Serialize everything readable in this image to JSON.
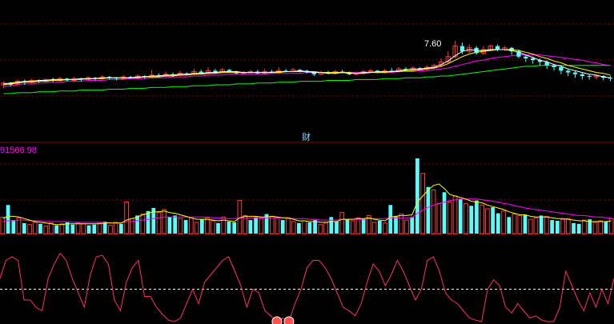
{
  "colors": {
    "background": "#000000",
    "grid": "#8b0000",
    "up": "#ff3b3b",
    "down": "#54ffff",
    "ma_short": "#ffffff",
    "ma_mid": "#ffff00",
    "ma_long": "#ff00ff",
    "ma_longest": "#00ff00",
    "vol_ma_short": "#ffff00",
    "vol_ma_long": "#ff00ff",
    "oscillator": "#ff2a7a",
    "osc_midline": "#ffffff",
    "marker": "#ff5050",
    "label_pink": "#ff00ff",
    "label_cyan": "#8fd3ff"
  },
  "chart_data": [
    {
      "type": "candlestick",
      "panel": "price",
      "annotation_high": "7.60",
      "separator_label": "财",
      "ylim": [
        0,
        100
      ],
      "candles": [
        [
          40,
          42,
          36,
          44
        ],
        [
          42,
          40,
          38,
          43
        ],
        [
          41,
          44,
          39,
          46
        ],
        [
          44,
          43,
          40,
          46
        ],
        [
          43,
          45,
          41,
          47
        ],
        [
          45,
          44,
          42,
          46
        ],
        [
          44,
          46,
          42,
          47
        ],
        [
          46,
          45,
          43,
          48
        ],
        [
          45,
          47,
          43,
          49
        ],
        [
          47,
          45,
          44,
          48
        ],
        [
          45,
          47,
          44,
          49
        ],
        [
          47,
          46,
          44,
          48
        ],
        [
          46,
          48,
          45,
          50
        ],
        [
          48,
          47,
          45,
          49
        ],
        [
          47,
          49,
          46,
          51
        ],
        [
          49,
          48,
          46,
          50
        ],
        [
          48,
          47,
          45,
          49
        ],
        [
          47,
          49,
          46,
          51
        ],
        [
          49,
          48,
          47,
          50
        ],
        [
          48,
          50,
          47,
          52
        ],
        [
          50,
          49,
          47,
          51
        ],
        [
          49,
          51,
          48,
          57
        ],
        [
          51,
          50,
          49,
          53
        ],
        [
          50,
          52,
          49,
          55
        ],
        [
          52,
          51,
          49,
          54
        ],
        [
          51,
          53,
          50,
          56
        ],
        [
          53,
          52,
          51,
          54
        ],
        [
          52,
          55,
          51,
          58
        ],
        [
          55,
          53,
          52,
          57
        ],
        [
          53,
          56,
          52,
          60
        ],
        [
          56,
          54,
          53,
          58
        ],
        [
          54,
          57,
          53,
          59
        ],
        [
          57,
          55,
          54,
          58
        ],
        [
          55,
          53,
          52,
          56
        ],
        [
          53,
          54,
          52,
          56
        ],
        [
          54,
          55,
          53,
          57
        ],
        [
          55,
          53,
          52,
          57
        ],
        [
          53,
          55,
          52,
          58
        ],
        [
          55,
          54,
          53,
          57
        ],
        [
          54,
          56,
          53,
          60
        ],
        [
          56,
          55,
          54,
          58
        ],
        [
          55,
          57,
          54,
          59
        ],
        [
          57,
          56,
          54,
          58
        ],
        [
          56,
          54,
          53,
          57
        ],
        [
          54,
          52,
          50,
          55
        ],
        [
          52,
          54,
          51,
          56
        ],
        [
          54,
          53,
          52,
          56
        ],
        [
          53,
          55,
          52,
          57
        ],
        [
          55,
          54,
          53,
          57
        ],
        [
          54,
          52,
          51,
          55
        ],
        [
          52,
          53,
          51,
          55
        ],
        [
          53,
          55,
          52,
          57
        ],
        [
          55,
          56,
          54,
          58
        ],
        [
          56,
          54,
          53,
          57
        ],
        [
          54,
          56,
          53,
          58
        ],
        [
          56,
          55,
          54,
          59
        ],
        [
          55,
          58,
          54,
          60
        ],
        [
          58,
          57,
          56,
          60
        ],
        [
          57,
          59,
          56,
          61
        ],
        [
          59,
          58,
          57,
          60
        ],
        [
          58,
          60,
          57,
          62
        ],
        [
          60,
          62,
          58,
          64
        ],
        [
          62,
          66,
          60,
          70
        ],
        [
          66,
          72,
          64,
          78
        ],
        [
          72,
          84,
          70,
          90
        ],
        [
          84,
          78,
          75,
          88
        ],
        [
          78,
          82,
          76,
          86
        ],
        [
          82,
          76,
          74,
          84
        ],
        [
          76,
          80,
          74,
          84
        ],
        [
          80,
          84,
          78,
          86
        ],
        [
          84,
          80,
          78,
          86
        ],
        [
          80,
          82,
          78,
          84
        ],
        [
          82,
          78,
          74,
          83
        ],
        [
          78,
          72,
          70,
          80
        ],
        [
          72,
          70,
          66,
          74
        ],
        [
          70,
          68,
          64,
          72
        ],
        [
          68,
          66,
          62,
          70
        ],
        [
          66,
          62,
          58,
          68
        ],
        [
          62,
          60,
          56,
          64
        ],
        [
          60,
          56,
          52,
          62
        ],
        [
          56,
          54,
          50,
          58
        ],
        [
          54,
          52,
          48,
          56
        ],
        [
          52,
          50,
          46,
          54
        ],
        [
          50,
          49,
          46,
          52
        ],
        [
          49,
          50,
          46,
          52
        ],
        [
          50,
          48,
          45,
          51
        ],
        [
          48,
          47,
          44,
          50
        ]
      ],
      "ma": {
        "ma_short": [
          41,
          42,
          43,
          44,
          44,
          45,
          45,
          46,
          46,
          46,
          46,
          47,
          47,
          47,
          48,
          48,
          48,
          48,
          48,
          49,
          49,
          50,
          50,
          51,
          51,
          52,
          52,
          53,
          53,
          54,
          54,
          55,
          55,
          55,
          54,
          54,
          54,
          54,
          54,
          55,
          55,
          55,
          56,
          55,
          54,
          54,
          53,
          53,
          54,
          53,
          53,
          54,
          54,
          55,
          55,
          55,
          56,
          57,
          58,
          58,
          59,
          60,
          63,
          67,
          73,
          78,
          80,
          79,
          79,
          80,
          80,
          80,
          79,
          77,
          74,
          71,
          68,
          66,
          63,
          61,
          58,
          56,
          54,
          52,
          51,
          49,
          48
        ],
        "ma_mid": [
          40,
          41,
          42,
          43,
          43,
          44,
          44,
          45,
          45,
          46,
          46,
          46,
          47,
          47,
          47,
          48,
          48,
          48,
          48,
          48,
          49,
          49,
          49,
          50,
          50,
          51,
          51,
          52,
          52,
          53,
          53,
          54,
          54,
          54,
          54,
          54,
          54,
          54,
          54,
          54,
          55,
          55,
          55,
          55,
          55,
          54,
          54,
          54,
          54,
          54,
          53,
          53,
          54,
          54,
          54,
          55,
          55,
          56,
          56,
          57,
          58,
          59,
          61,
          64,
          68,
          72,
          75,
          77,
          78,
          79,
          80,
          80,
          80,
          79,
          77,
          75,
          72,
          70,
          67,
          65,
          62,
          60,
          58,
          56,
          54,
          53,
          51
        ],
        "ma_long": [
          38,
          39,
          40,
          41,
          41,
          42,
          42,
          43,
          43,
          44,
          44,
          44,
          45,
          45,
          45,
          46,
          46,
          46,
          47,
          47,
          47,
          48,
          48,
          48,
          49,
          49,
          49,
          50,
          50,
          51,
          51,
          51,
          52,
          52,
          52,
          52,
          52,
          52,
          53,
          53,
          53,
          53,
          53,
          54,
          54,
          54,
          54,
          54,
          54,
          54,
          54,
          54,
          54,
          54,
          54,
          54,
          55,
          55,
          55,
          56,
          56,
          57,
          58,
          59,
          61,
          63,
          65,
          67,
          68,
          70,
          71,
          72,
          73,
          74,
          74,
          74,
          74,
          73,
          72,
          71,
          70,
          69,
          68,
          66,
          65,
          63,
          62
        ],
        "ma_longest": [
          30,
          30,
          31,
          31,
          31,
          32,
          32,
          32,
          33,
          33,
          33,
          34,
          34,
          34,
          34,
          35,
          35,
          35,
          36,
          36,
          36,
          37,
          37,
          37,
          38,
          38,
          38,
          39,
          39,
          39,
          40,
          40,
          40,
          41,
          41,
          41,
          42,
          42,
          42,
          43,
          43,
          43,
          44,
          44,
          44,
          44,
          45,
          45,
          45,
          45,
          46,
          46,
          46,
          46,
          47,
          47,
          47,
          48,
          48,
          48,
          49,
          49,
          50,
          50,
          51,
          52,
          53,
          54,
          55,
          56,
          57,
          58,
          59,
          60,
          61,
          61,
          62,
          62,
          62,
          62,
          62,
          62,
          62,
          62,
          62,
          62,
          62
        ]
      }
    },
    {
      "type": "bar",
      "panel": "volume",
      "label": "91566.98",
      "ylim": [
        0,
        100
      ],
      "values": [
        22,
        38,
        18,
        21,
        14,
        12,
        15,
        13,
        10,
        14,
        11,
        13,
        15,
        12,
        14,
        13,
        11,
        12,
        14,
        16,
        11,
        15,
        13,
        42,
        20,
        24,
        26,
        30,
        34,
        28,
        32,
        22,
        24,
        20,
        18,
        21,
        15,
        19,
        21,
        17,
        14,
        22,
        16,
        15,
        44,
        24,
        18,
        22,
        20,
        26,
        23,
        21,
        18,
        20,
        16,
        14,
        17,
        15,
        18,
        12,
        14,
        22,
        16,
        28,
        19,
        17,
        21,
        20,
        24,
        15,
        17,
        14,
        38,
        23,
        26,
        18,
        22,
        100,
        80,
        62,
        58,
        40,
        55,
        42,
        50,
        46,
        40,
        37,
        44,
        38,
        33,
        35,
        27,
        30,
        22,
        26,
        24,
        25,
        19,
        21,
        24,
        23,
        18,
        17,
        19,
        20,
        14,
        13,
        18,
        19,
        15,
        17,
        16,
        20
      ],
      "ma_short": [
        20,
        23,
        23,
        22,
        20,
        18,
        16,
        15,
        14,
        13,
        12,
        12,
        13,
        13,
        13,
        13,
        13,
        13,
        13,
        14,
        14,
        14,
        14,
        18,
        20,
        22,
        25,
        27,
        29,
        29,
        30,
        28,
        27,
        25,
        23,
        21,
        19,
        19,
        19,
        18,
        17,
        18,
        17,
        16,
        21,
        23,
        23,
        23,
        22,
        22,
        23,
        22,
        21,
        21,
        19,
        17,
        17,
        16,
        16,
        15,
        15,
        16,
        16,
        19,
        19,
        19,
        20,
        20,
        21,
        19,
        18,
        17,
        22,
        23,
        24,
        24,
        25,
        42,
        50,
        58,
        64,
        66,
        60,
        52,
        50,
        48,
        46,
        43,
        42,
        41,
        38,
        36,
        34,
        32,
        29,
        27,
        25,
        25,
        23,
        22,
        22,
        22,
        21,
        20,
        20,
        19,
        18,
        17,
        17,
        16,
        16,
        16,
        16,
        17
      ],
      "ma_long": [
        16,
        17,
        17,
        18,
        18,
        17,
        17,
        17,
        16,
        16,
        16,
        16,
        16,
        15,
        15,
        15,
        15,
        15,
        15,
        15,
        14,
        14,
        14,
        16,
        16,
        17,
        18,
        19,
        20,
        21,
        22,
        22,
        22,
        22,
        22,
        22,
        22,
        22,
        22,
        21,
        21,
        20,
        20,
        20,
        21,
        21,
        21,
        21,
        21,
        21,
        21,
        21,
        21,
        21,
        20,
        20,
        20,
        19,
        19,
        18,
        18,
        18,
        18,
        19,
        19,
        19,
        19,
        19,
        20,
        20,
        20,
        20,
        21,
        21,
        21,
        21,
        21,
        27,
        31,
        35,
        38,
        40,
        42,
        44,
        45,
        46,
        46,
        46,
        46,
        45,
        44,
        43,
        42,
        40,
        39,
        37,
        36,
        34,
        33,
        32,
        31,
        30,
        29,
        28,
        27,
        26,
        25,
        24,
        24,
        23,
        22,
        22,
        21,
        21
      ]
    },
    {
      "type": "line",
      "panel": "oscillator",
      "ylim": [
        0,
        100
      ],
      "midline": 45,
      "values": [
        60,
        85,
        90,
        85,
        30,
        30,
        20,
        15,
        60,
        80,
        95,
        85,
        60,
        40,
        20,
        65,
        90,
        92,
        80,
        30,
        15,
        55,
        75,
        85,
        35,
        35,
        20,
        10,
        2,
        0,
        5,
        25,
        45,
        25,
        55,
        65,
        75,
        85,
        90,
        70,
        50,
        20,
        45,
        40,
        15,
        8,
        0,
        5,
        0,
        25,
        45,
        75,
        85,
        85,
        75,
        60,
        40,
        20,
        15,
        8,
        25,
        55,
        80,
        70,
        50,
        65,
        85,
        70,
        50,
        30,
        45,
        85,
        90,
        70,
        40,
        30,
        25,
        15,
        5,
        2,
        0,
        45,
        58,
        50,
        20,
        12,
        25,
        15,
        5,
        8,
        2,
        0,
        0,
        20,
        70,
        50,
        30,
        15,
        40,
        20,
        45,
        25,
        60
      ]
    }
  ]
}
